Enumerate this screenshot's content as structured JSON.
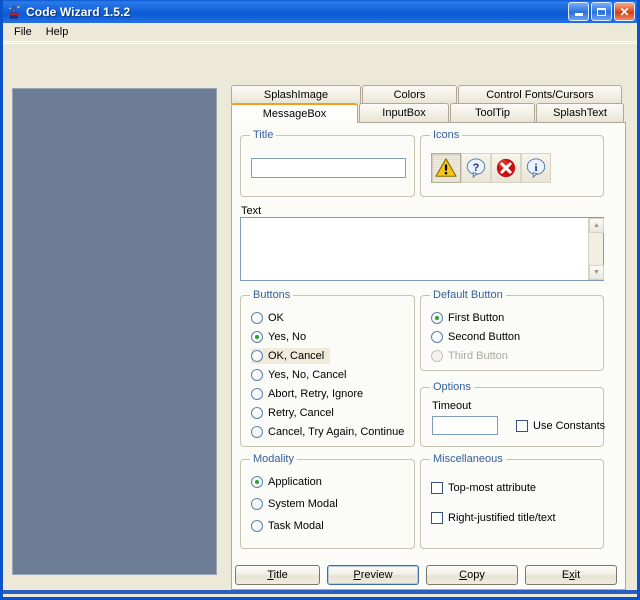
{
  "window": {
    "title": "Code Wizard 1.5.2",
    "icon": "wizard-hat-icon",
    "controls": {
      "minimize": "minimize-button",
      "maximize": "maximize-button",
      "close_glyph": "✕"
    }
  },
  "menubar": {
    "items": [
      {
        "label": "File"
      },
      {
        "label": "Help"
      }
    ]
  },
  "tabs": {
    "row1": [
      {
        "id": "splashimage",
        "label": "SplashImage",
        "selected": false
      },
      {
        "id": "colors",
        "label": "Colors",
        "selected": false
      },
      {
        "id": "ctrlfonts",
        "label": "Control Fonts/Cursors",
        "selected": false
      }
    ],
    "row2": [
      {
        "id": "messagebox",
        "label": "MessageBox",
        "selected": true
      },
      {
        "id": "inputbox",
        "label": "InputBox",
        "selected": false
      },
      {
        "id": "tooltip",
        "label": "ToolTip",
        "selected": false
      },
      {
        "id": "splashtext",
        "label": "SplashText",
        "selected": false
      }
    ]
  },
  "messagebox": {
    "title_group": {
      "legend": "Title",
      "value": "",
      "placeholder": ""
    },
    "icons_group": {
      "legend": "Icons",
      "buttons": [
        {
          "name": "warning-icon",
          "selected": true
        },
        {
          "name": "question-icon",
          "selected": false
        },
        {
          "name": "error-icon",
          "selected": false
        },
        {
          "name": "information-icon",
          "selected": false
        }
      ]
    },
    "text_group": {
      "label": "Text",
      "value": "",
      "placeholder": ""
    },
    "buttons_group": {
      "legend": "Buttons",
      "options": [
        {
          "label": "OK",
          "selected": false,
          "highlighted": false
        },
        {
          "label": "Yes, No",
          "selected": true,
          "highlighted": false
        },
        {
          "label": "OK, Cancel",
          "selected": false,
          "highlighted": true
        },
        {
          "label": "Yes, No, Cancel",
          "selected": false,
          "highlighted": false
        },
        {
          "label": "Abort, Retry, Ignore",
          "selected": false,
          "highlighted": false
        },
        {
          "label": "Retry, Cancel",
          "selected": false,
          "highlighted": false
        },
        {
          "label": "Cancel, Try Again, Continue",
          "selected": false,
          "highlighted": false
        }
      ]
    },
    "default_button_group": {
      "legend": "Default Button",
      "options": [
        {
          "label": "First Button",
          "selected": true,
          "disabled": false
        },
        {
          "label": "Second Button",
          "selected": false,
          "disabled": false
        },
        {
          "label": "Third Button",
          "selected": false,
          "disabled": true
        }
      ]
    },
    "options_group": {
      "legend": "Options",
      "timeout_label": "Timeout",
      "timeout_value": "",
      "use_constants_label": "Use Constants",
      "use_constants_checked": false
    },
    "modality_group": {
      "legend": "Modality",
      "options": [
        {
          "label": "Application",
          "selected": true
        },
        {
          "label": "System Modal",
          "selected": false
        },
        {
          "label": "Task Modal",
          "selected": false
        }
      ]
    },
    "miscellaneous_group": {
      "legend": "Miscellaneous",
      "options": [
        {
          "label": "Top-most attribute",
          "checked": false
        },
        {
          "label": "Right-justified title/text",
          "checked": false
        }
      ]
    }
  },
  "footer_buttons": [
    {
      "id": "title",
      "accel": "T",
      "rest": "itle",
      "focused": false
    },
    {
      "id": "preview",
      "accel": "P",
      "rest": "review",
      "focused": true
    },
    {
      "id": "copy",
      "accel": "C",
      "rest": "opy",
      "focused": false
    },
    {
      "id": "exit",
      "pre": "E",
      "accel": "x",
      "rest": "it",
      "focused": false
    }
  ],
  "colors": {
    "titlebar_blue": "#1866dc",
    "window_bg": "#ece9d8",
    "preview_panel": "#6d7d95",
    "legend_blue": "#35609c",
    "selected_tab_accent": "#f0a020",
    "radio_dot_green": "#2f9e2f"
  }
}
